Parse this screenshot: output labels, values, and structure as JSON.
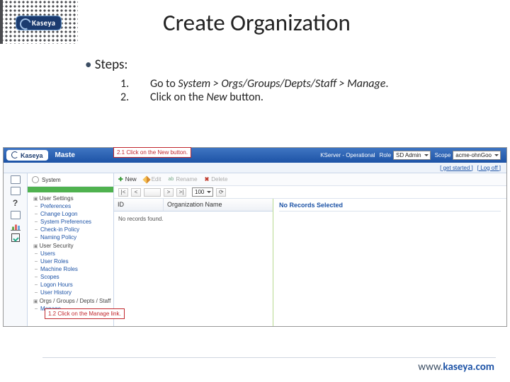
{
  "slide": {
    "logo": "Kaseya",
    "title": "Create Organization",
    "bullet": "Steps:",
    "steps": [
      {
        "num": "1.",
        "text_pre": "Go to ",
        "text_em": "System > Orgs/Groups/Depts/Staff > Manage",
        "text_post": "."
      },
      {
        "num": "2.",
        "text_pre": "Click on the ",
        "text_em": "New",
        "text_post": " button."
      }
    ]
  },
  "app": {
    "logo": "Kaseya",
    "maste": "Maste",
    "callout1": "2.1 Click on the New button.",
    "callout2": "1.2 Click on the Manage link.",
    "top": {
      "server_label": "KServer - Operational",
      "role_label": "Role",
      "role_value": "SD Admin",
      "scope_label": "Scope",
      "scope_value": "acme-ohnGoo"
    },
    "subbar": {
      "getstarted": "[ get started ]",
      "logoff": "[ Log off ]"
    },
    "side": {
      "system": "System",
      "user_settings": "User Settings",
      "items1": [
        "Preferences",
        "Change Logon",
        "System Preferences",
        "Check-in Policy",
        "Naming Policy"
      ],
      "user_security": "User Security",
      "items2": [
        "Users",
        "User Roles",
        "Machine Roles",
        "Scopes",
        "Logon Hours",
        "User History"
      ],
      "orgs": "Orgs / Groups / Depts / Staff",
      "manage": "Manage"
    },
    "toolbar": {
      "new": "New",
      "edit": "Edit",
      "rename": "Rename",
      "delete": "Delete"
    },
    "pager": {
      "size": "100"
    },
    "grid": {
      "id": "ID",
      "orgname": "Organization Name",
      "norecords": "No records found."
    },
    "detail": {
      "none": "No Records Selected"
    }
  },
  "footer": {
    "www": "www.",
    "domain": "kaseya.com"
  }
}
